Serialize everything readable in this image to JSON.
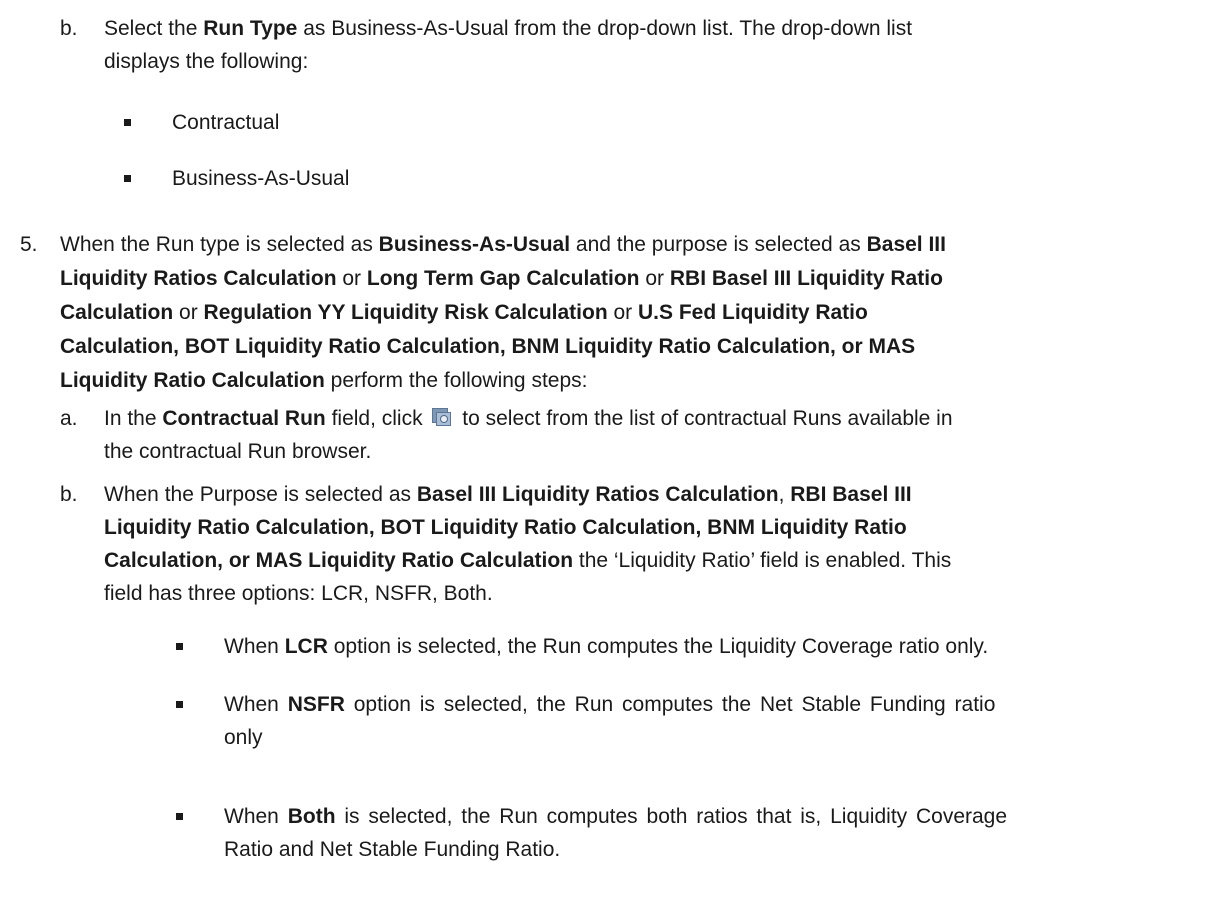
{
  "step4b": {
    "marker": "b.",
    "t1": "Select the ",
    "b1": "Run Type",
    "t2": " as Business-As-Usual from the drop-down list. The drop-down list",
    "line2": "displays the following:"
  },
  "run_type_options": [
    "Contractual",
    "Business-As-Usual"
  ],
  "step5": {
    "marker": "5.",
    "l1_t1": "When the Run type is selected as ",
    "l1_b1": "Business-As-Usual",
    "l1_t2": " and the purpose is selected as ",
    "l1_b2": "Basel III",
    "l2_b1": "Liquidity Ratios Calculation",
    "l2_t1": " or ",
    "l2_b2": "Long Term Gap Calculation",
    "l2_t2": " or ",
    "l2_b3": "RBI Basel III Liquidity Ratio",
    "l3_b1": "Calculation",
    "l3_t1": " or ",
    "l3_b2": "Regulation YY Liquidity Risk Calculation",
    "l3_t2": " or ",
    "l3_b3": "U.S Fed Liquidity Ratio",
    "l4_b1": "Calculation, BOT Liquidity Ratio Calculation, BNM Liquidity Ratio Calculation, or MAS",
    "l5_b1": "Liquidity Ratio Calculation",
    "l5_t1": " perform the following steps:"
  },
  "step5a": {
    "marker": "a.",
    "t1": "In the ",
    "b1": "Contractual Run",
    "t2": " field, click",
    "t3": "to select from the list of contractual Runs available in",
    "line2": "the contractual Run browser.",
    "icon": "browse-run-icon"
  },
  "step5b": {
    "marker": "b.",
    "l1_t1": "When the Purpose is selected as ",
    "l1_b1": "Basel III Liquidity Ratios Calculation",
    "l1_t2": ", ",
    "l1_b2": "RBI Basel III",
    "l2_b1": "Liquidity Ratio Calculation, BOT Liquidity Ratio Calculation, BNM Liquidity Ratio",
    "l3_b1": "Calculation, or MAS Liquidity Ratio Calculation",
    "l3_t1": " the ‘Liquidity Ratio’ field is enabled. This",
    "l4_t1": "field has three options: LCR, NSFR, Both."
  },
  "liquidity_options": [
    {
      "t1": "When ",
      "b1": "LCR",
      "t2": " option is selected, the Run computes the Liquidity Coverage ratio only."
    },
    {
      "t1": "When ",
      "b1": "NSFR",
      "t2": " option is selected, the Run computes the Net Stable Funding ratio",
      "line2": "only"
    },
    {
      "t1": "When ",
      "b1": "Both",
      "t2": " is selected, the Run computes both ratios that is, Liquidity Coverage",
      "line2": "Ratio and Net Stable Funding Ratio."
    }
  ]
}
